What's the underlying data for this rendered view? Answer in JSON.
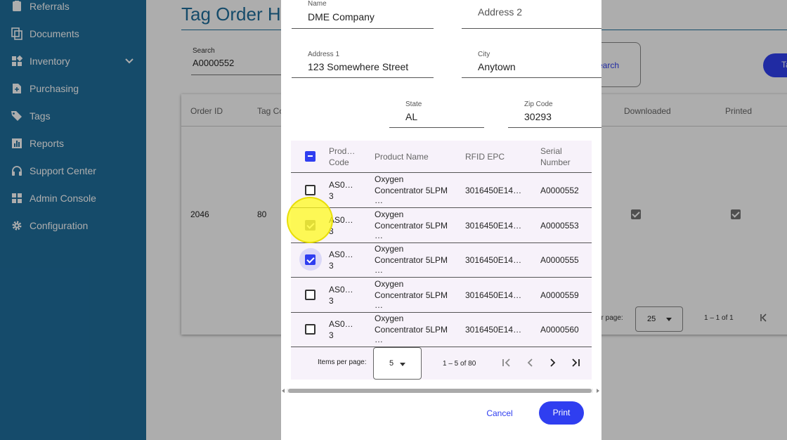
{
  "colors": {
    "sidebar": "#1f6f9d",
    "accent": "#2f3ef0",
    "highlight": "#fffa1e"
  },
  "sidebar": {
    "items": [
      {
        "label": "Referrals",
        "icon": "referrals-icon"
      },
      {
        "label": "Documents",
        "icon": "documents-icon"
      },
      {
        "label": "Inventory",
        "icon": "inventory-icon",
        "expandable": true
      },
      {
        "label": "Purchasing",
        "icon": "purchasing-icon"
      },
      {
        "label": "Tags",
        "icon": "tags-icon"
      },
      {
        "label": "Reports",
        "icon": "reports-icon"
      },
      {
        "label": "Support Center",
        "icon": "headset-icon"
      },
      {
        "label": "Admin Console",
        "icon": "admin-console-icon"
      },
      {
        "label": "Configuration",
        "icon": "gear-icon"
      }
    ]
  },
  "background": {
    "title": "Tag Order H",
    "search": {
      "label": "Search",
      "value": "A0000552",
      "button": "earch"
    },
    "tag_button": "Ta",
    "table": {
      "headers": {
        "order_id": "Order ID",
        "tag_count": "Tag Co",
        "downloaded": "Downloaded",
        "printed": "Printed"
      },
      "row": {
        "order_id": "2046",
        "tag_count": "80",
        "downloaded": true,
        "printed": true
      }
    },
    "pager": {
      "label": "er page:",
      "value": "25",
      "range": "1 – 1 of 1"
    }
  },
  "dialog": {
    "fields": {
      "name": {
        "label": "Name",
        "value": "DME Company"
      },
      "address2": {
        "label": "Address 2",
        "value": ""
      },
      "address1": {
        "label": "Address 1",
        "value": "123 Somewhere Street"
      },
      "city": {
        "label": "City",
        "value": "Anytown"
      },
      "state": {
        "label": "State",
        "value": "AL"
      },
      "zip": {
        "label": "Zip Code",
        "value": "30293"
      }
    },
    "table": {
      "headers": {
        "product_code": [
          "Prod…",
          "Code"
        ],
        "product_name": "Product Name",
        "rfid_epc": "RFID EPC",
        "serial_number": [
          "Serial",
          "Number"
        ]
      },
      "rows": [
        {
          "code": [
            "AS0…",
            "3"
          ],
          "name": [
            "Oxygen",
            "Concentrator 5LPM",
            "…"
          ],
          "epc": "3016450E14…",
          "serial": "A0000552",
          "state": "unchecked"
        },
        {
          "code": [
            "AS0…",
            "3"
          ],
          "name": [
            "Oxygen",
            "Concentrator 5LPM",
            "…"
          ],
          "epc": "3016450E14…",
          "serial": "A0000553",
          "state": "checked-dim"
        },
        {
          "code": [
            "AS0…",
            "3"
          ],
          "name": [
            "Oxygen",
            "Concentrator 5LPM",
            "…"
          ],
          "epc": "3016450E14…",
          "serial": "A0000555",
          "state": "checked"
        },
        {
          "code": [
            "AS0…",
            "3"
          ],
          "name": [
            "Oxygen",
            "Concentrator 5LPM",
            "…"
          ],
          "epc": "3016450E14…",
          "serial": "A0000559",
          "state": "unchecked"
        },
        {
          "code": [
            "AS0…",
            "3"
          ],
          "name": [
            "Oxygen",
            "Concentrator 5LPM",
            "…"
          ],
          "epc": "3016450E14…",
          "serial": "A0000560",
          "state": "unchecked"
        }
      ]
    },
    "pager": {
      "label": "Items per page:",
      "value": "5",
      "range": "1 – 5 of 80"
    },
    "buttons": {
      "cancel": "Cancel",
      "print": "Print"
    }
  }
}
